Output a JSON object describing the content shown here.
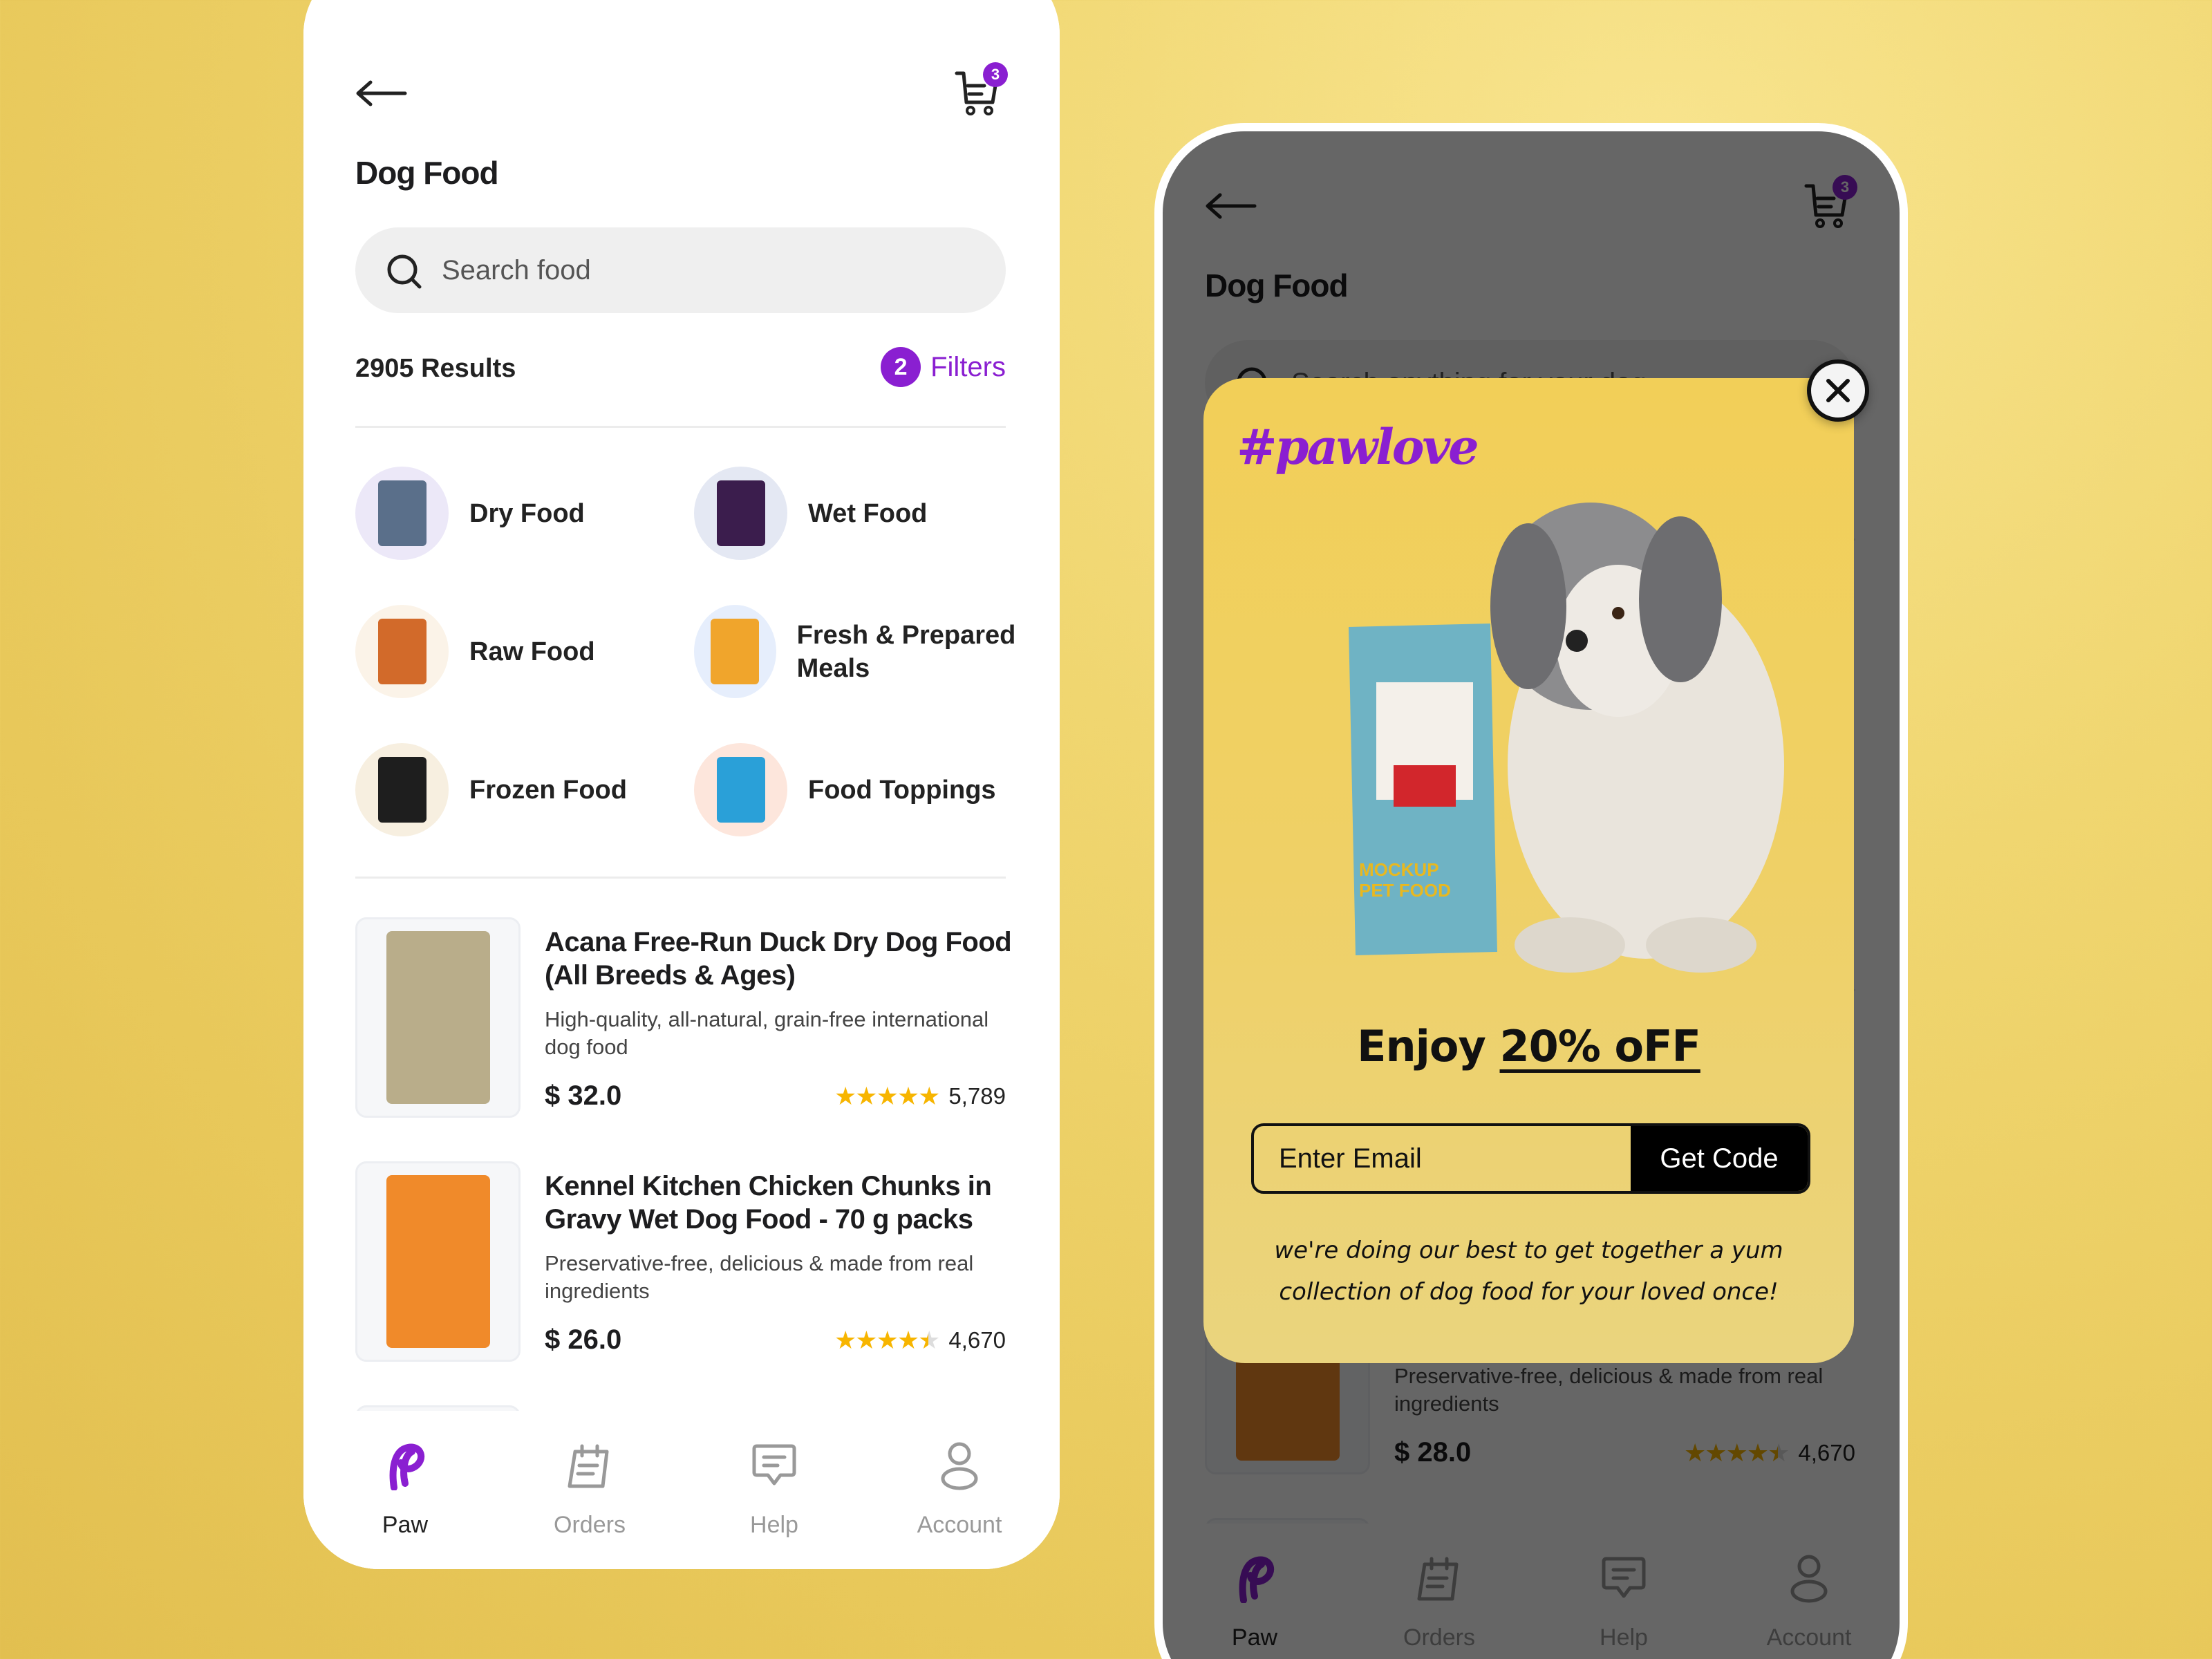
{
  "colors": {
    "accent": "#8a1fd1",
    "star": "#f7b500",
    "background": "#f0d670"
  },
  "screen_left": {
    "back_icon": "arrow-left-icon",
    "cart": {
      "icon": "cart-icon",
      "count": "3"
    },
    "title": "Dog Food",
    "search": {
      "placeholder": "Search food"
    },
    "results": "2905 Results",
    "filters": {
      "count": "2",
      "label": "Filters"
    },
    "categories": [
      {
        "label": "Dry Food",
        "bg": "#ece8f8",
        "pack": "#5a6f8a"
      },
      {
        "label": "Wet Food",
        "bg": "#e4e8f3",
        "pack": "#3b1d4d"
      },
      {
        "label": "Raw Food",
        "bg": "#fbf3e8",
        "pack": "#d26a2a"
      },
      {
        "label": "Fresh & Prepared Meals",
        "bg": "#e6eefc",
        "pack": "#f0a52c"
      },
      {
        "label": "Frozen Food",
        "bg": "#f7efe0",
        "pack": "#1e1e1e"
      },
      {
        "label": "Food Toppings",
        "bg": "#fde6dc",
        "pack": "#2aa0d8"
      }
    ],
    "products": [
      {
        "title": "Acana Free-Run Duck Dry Dog Food (All Breeds & Ages)",
        "desc": "High-quality, all-natural, grain-free international dog food",
        "price": "$ 32.0",
        "rating": 5,
        "stars": "★★★★★",
        "reviews": "5,789",
        "pack": "#b9ad8a"
      },
      {
        "title": "Kennel Kitchen Chicken Chunks in Gravy Wet Dog Food - 70 g packs",
        "desc": "Preservative-free, delicious & made from real ingredients",
        "price": "$ 26.0",
        "rating": 4.5,
        "stars": "★★★★★",
        "reviews": "4,670",
        "pack": "#f08a2a"
      }
    ],
    "nav": [
      {
        "label": "Paw",
        "icon": "paw-logo-icon",
        "active": true
      },
      {
        "label": "Orders",
        "icon": "orders-icon"
      },
      {
        "label": "Help",
        "icon": "help-chat-icon"
      },
      {
        "label": "Account",
        "icon": "account-icon"
      }
    ]
  },
  "screen_right": {
    "back_icon": "arrow-left-icon",
    "cart": {
      "icon": "cart-icon",
      "count": "3"
    },
    "title": "Dog Food",
    "search": {
      "placeholder": "Search anything for your dog"
    },
    "results": "",
    "filters": {
      "count": "",
      "label": ""
    },
    "categories": [],
    "products": [
      {
        "title": "",
        "desc": "",
        "price": "",
        "rating": 0,
        "stars": "",
        "reviews": "",
        "pack": "#b9ad8a"
      },
      {
        "title": "",
        "desc": "Preservative-free, delicious & made from real ingredients",
        "price": "$ 28.0",
        "rating": 4.5,
        "stars": "★★★★★",
        "reviews": "4,670",
        "pack": "#f08a2a"
      }
    ],
    "nav": [
      {
        "label": "Paw",
        "icon": "paw-logo-icon",
        "active": true
      },
      {
        "label": "Orders",
        "icon": "orders-icon"
      },
      {
        "label": "Help",
        "icon": "help-chat-icon"
      },
      {
        "label": "Account",
        "icon": "account-icon"
      }
    ]
  },
  "modal": {
    "hashtag": "#pawlove",
    "headline_prefix": "Enjoy ",
    "headline_offer": "20% oFF",
    "email_placeholder": "Enter Email",
    "button": "Get Code",
    "message": "we're doing our best to get together a yum collection of dog food for your loved once!",
    "close_icon": "close-icon",
    "image_label": "MOCKUP PET FOOD"
  }
}
